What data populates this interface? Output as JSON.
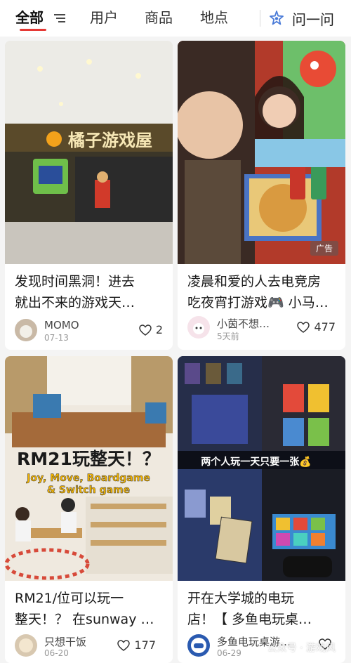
{
  "tabs": [
    {
      "label": "全部"
    },
    {
      "label": "用户"
    },
    {
      "label": "商品"
    },
    {
      "label": "地点"
    }
  ],
  "ask": {
    "label": "问一问"
  },
  "cards": [
    {
      "title": "发现时间黑洞！进去就出不来的游戏天…",
      "title_lines": [
        "发现时间黑洞！进去",
        "就出不来的游戏天…"
      ],
      "author": "MOMO",
      "date": "07-13",
      "likes": "2",
      "thumb_sign": "橘子游戏屋"
    },
    {
      "title": "凌晨和爱的人去电竞房吃夜宵打游戏🎮 小马…",
      "title_lines": [
        "凌晨和爱的人去电竞房",
        "吃夜宵打游戏🎮 小马…"
      ],
      "author": "小茵不想…",
      "date": "5天前",
      "likes": "477",
      "ad_label": "广告"
    },
    {
      "title": "RM21/位可以玩一整天！？ 在sunway …",
      "title_lines": [
        "RM21/位可以玩一",
        "整天！？ 在sunway …"
      ],
      "author": "只想干饭",
      "date": "06-20",
      "likes": "177",
      "thumb_headline": "RM21玩整天！？",
      "thumb_caption_1": "Joy, Move, Boardgame",
      "thumb_caption_2": "& Switch game"
    },
    {
      "title": "开在大学城的电玩店！【 多鱼电玩桌…",
      "title_lines": [
        "开在大学城的电玩",
        "店！【 多鱼电玩桌…"
      ],
      "author": "多鱼电玩桌游…",
      "date": "06-29",
      "likes": "",
      "thumb_headline": "两个人玩一天只要一张💰"
    }
  ],
  "watermark": "公众号 · 游戏风",
  "icons": {
    "filter": "filter-lines-icon",
    "ask": "sparkle-star-icon",
    "like": "heart-outline-icon"
  },
  "colors": {
    "accent": "#e53935",
    "ask_icon": "#4a7bd8"
  }
}
